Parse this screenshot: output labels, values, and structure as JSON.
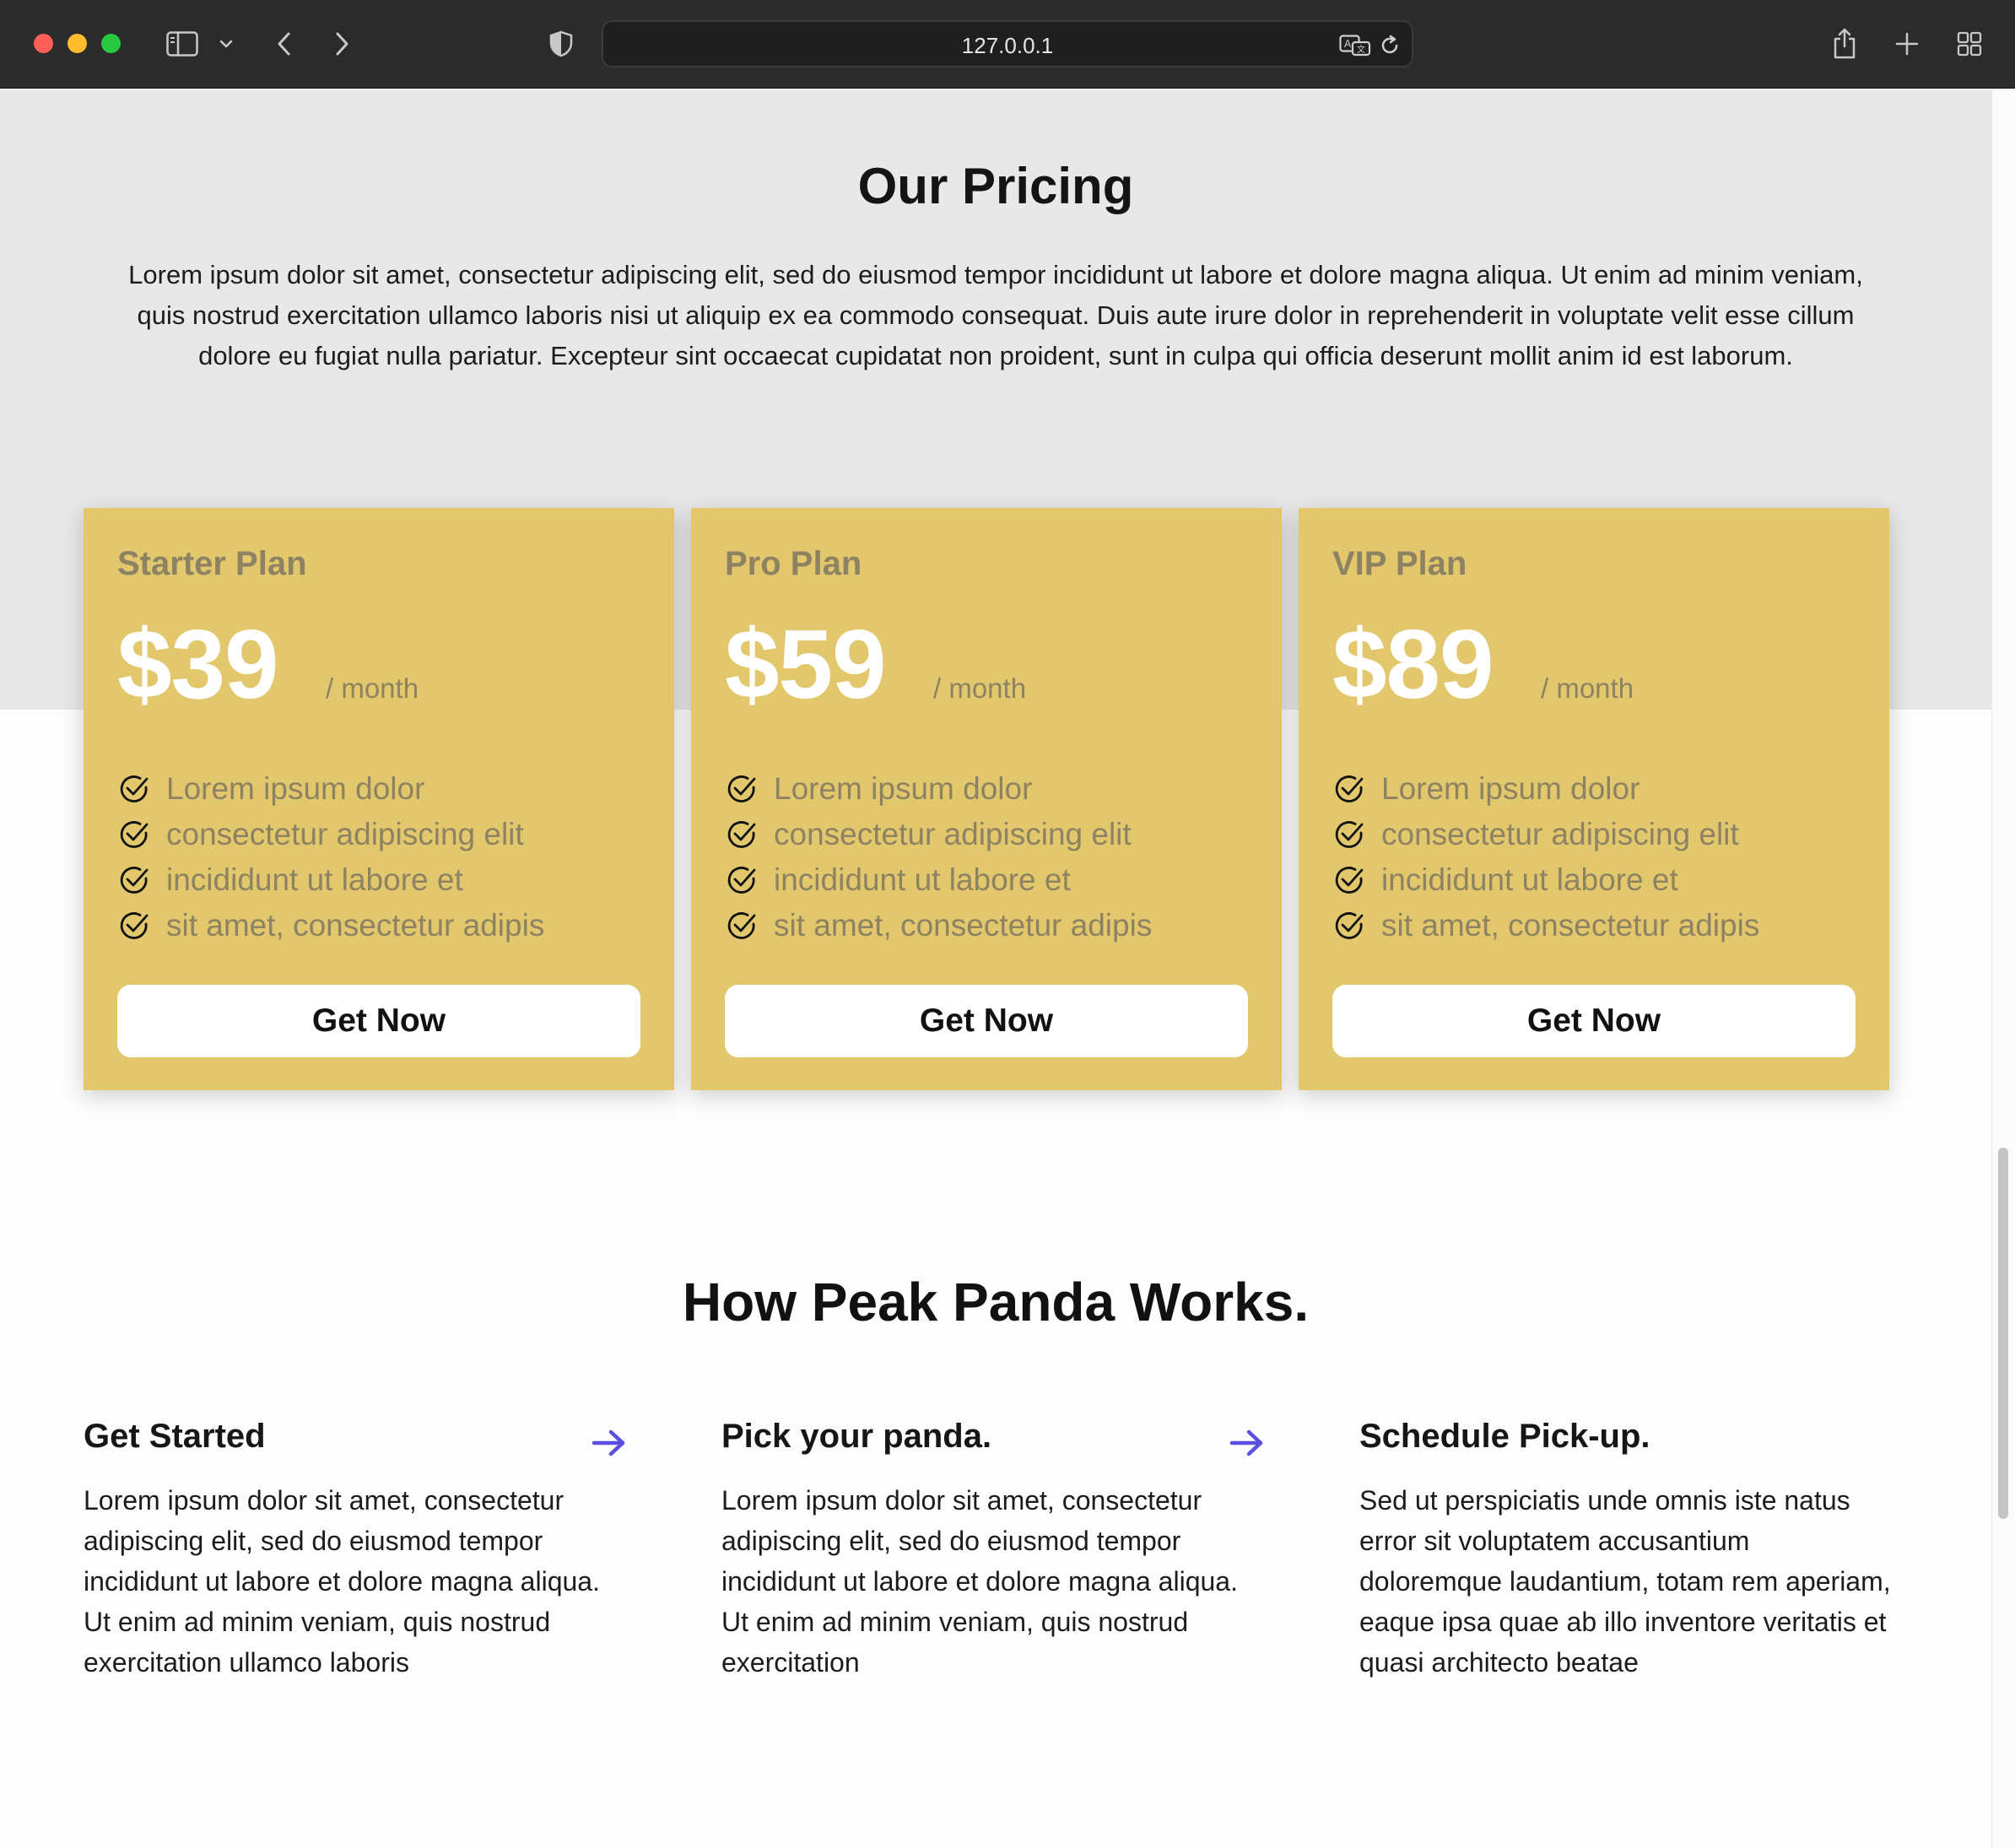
{
  "browser": {
    "url": "127.0.0.1",
    "icons": [
      "sidebar-icon",
      "chevron-down-icon",
      "back-icon",
      "forward-icon",
      "shield-icon",
      "translate-icon",
      "reload-icon",
      "share-icon",
      "new-tab-icon",
      "tab-overview-icon"
    ]
  },
  "pricing": {
    "title": "Our Pricing",
    "lead": "Lorem ipsum dolor sit amet, consectetur adipiscing elit, sed do eiusmod tempor incididunt ut labore et dolore magna aliqua. Ut enim ad minim veniam, quis nostrud exercitation ullamco laboris nisi ut aliquip ex ea commodo consequat. Duis aute irure dolor in reprehenderit in voluptate velit esse cillum dolore eu fugiat nulla pariatur. Excepteur sint occaecat cupidatat non proident, sunt in culpa qui officia deserunt mollit anim id est laborum.",
    "plans": [
      {
        "name": "Starter Plan",
        "price": "$39",
        "period": "/ month",
        "features": [
          "Lorem ipsum dolor",
          "consectetur adipiscing elit",
          "incididunt ut labore et",
          "sit amet, consectetur adipis"
        ],
        "cta": "Get Now"
      },
      {
        "name": "Pro Plan",
        "price": "$59",
        "period": "/ month",
        "features": [
          "Lorem ipsum dolor",
          "consectetur adipiscing elit",
          "incididunt ut labore et",
          "sit amet, consectetur adipis"
        ],
        "cta": "Get Now"
      },
      {
        "name": "VIP Plan",
        "price": "$89",
        "period": "/ month",
        "features": [
          "Lorem ipsum dolor",
          "consectetur adipiscing elit",
          "incididunt ut labore et",
          "sit amet, consectetur adipis"
        ],
        "cta": "Get Now"
      }
    ]
  },
  "works": {
    "title": "How Peak Panda Works.",
    "steps": [
      {
        "title": "Get Started",
        "body": "Lorem ipsum dolor sit amet, consectetur adipiscing elit, sed do eiusmod tempor incididunt ut labore et dolore magna aliqua. Ut enim ad minim veniam, quis nostrud exercitation ullamco laboris"
      },
      {
        "title": "Pick your panda.",
        "body": "Lorem ipsum dolor sit amet, consectetur adipiscing elit, sed do eiusmod tempor incididunt ut labore et dolore magna aliqua. Ut enim ad minim veniam, quis nostrud exercitation"
      },
      {
        "title": "Schedule Pick-up.",
        "body": "Sed ut perspiciatis unde omnis iste natus error sit voluptatem accusantium doloremque laudantium, totam rem aperiam, eaque ipsa quae ab illo inventore veritatis et quasi architecto beatae"
      }
    ]
  },
  "colors": {
    "card": "#e2c76d",
    "card_muted_text": "#8d8262",
    "band": "#e8e8e8",
    "arrow": "#5b4fe0"
  }
}
